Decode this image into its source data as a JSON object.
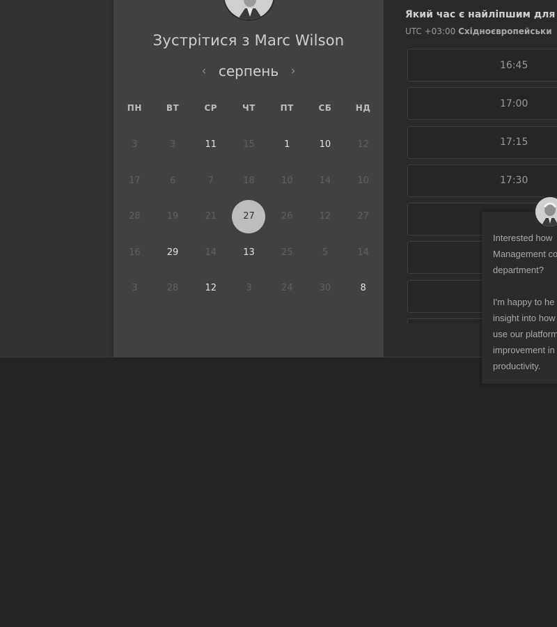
{
  "header": {
    "meet_title": "Зустрітися з Marc Wilson",
    "month": "серпень",
    "prev_arrow": "‹",
    "next_arrow": "›"
  },
  "calendar": {
    "weekdays": [
      "ПН",
      "ВТ",
      "СР",
      "ЧТ",
      "ПТ",
      "СБ",
      "НД"
    ],
    "rows": [
      [
        {
          "d": "3",
          "a": false
        },
        {
          "d": "3",
          "a": false
        },
        {
          "d": "11",
          "a": true
        },
        {
          "d": "15",
          "a": false
        },
        {
          "d": "1",
          "a": true
        },
        {
          "d": "10",
          "a": true
        },
        {
          "d": "12",
          "a": false
        }
      ],
      [
        {
          "d": "17",
          "a": false
        },
        {
          "d": "6",
          "a": false
        },
        {
          "d": "7",
          "a": false
        },
        {
          "d": "18",
          "a": false
        },
        {
          "d": "10",
          "a": false
        },
        {
          "d": "14",
          "a": false
        },
        {
          "d": "10",
          "a": false
        }
      ],
      [
        {
          "d": "28",
          "a": false
        },
        {
          "d": "19",
          "a": false
        },
        {
          "d": "21",
          "a": false
        },
        {
          "d": "27",
          "a": true,
          "selected": true
        },
        {
          "d": "26",
          "a": false
        },
        {
          "d": "12",
          "a": false
        },
        {
          "d": "27",
          "a": false
        }
      ],
      [
        {
          "d": "16",
          "a": false
        },
        {
          "d": "29",
          "a": true
        },
        {
          "d": "14",
          "a": false
        },
        {
          "d": "13",
          "a": true
        },
        {
          "d": "25",
          "a": false
        },
        {
          "d": "5",
          "a": false
        },
        {
          "d": "14",
          "a": false
        }
      ],
      [
        {
          "d": "3",
          "a": false
        },
        {
          "d": "28",
          "a": false
        },
        {
          "d": "12",
          "a": true
        },
        {
          "d": "3",
          "a": false
        },
        {
          "d": "24",
          "a": false
        },
        {
          "d": "30",
          "a": false
        },
        {
          "d": "8",
          "a": true
        }
      ]
    ]
  },
  "time_panel": {
    "heading": "Який час є найліпшим для ва",
    "timezone_prefix": "UTC +03:00",
    "timezone_name": "Східноєвропейськи",
    "slots": [
      "16:45",
      "17:00",
      "17:15",
      "17:30",
      "",
      "",
      "",
      ""
    ]
  },
  "chat": {
    "message": "Interested how\nManagement co\ndepartment?\n\nI'm happy to he\ninsight into how\nuse our platform\nimprovement in\nproductivity."
  },
  "icons": {
    "avatar": "person-avatar-icon",
    "chat_avatar": "person-avatar-icon"
  }
}
